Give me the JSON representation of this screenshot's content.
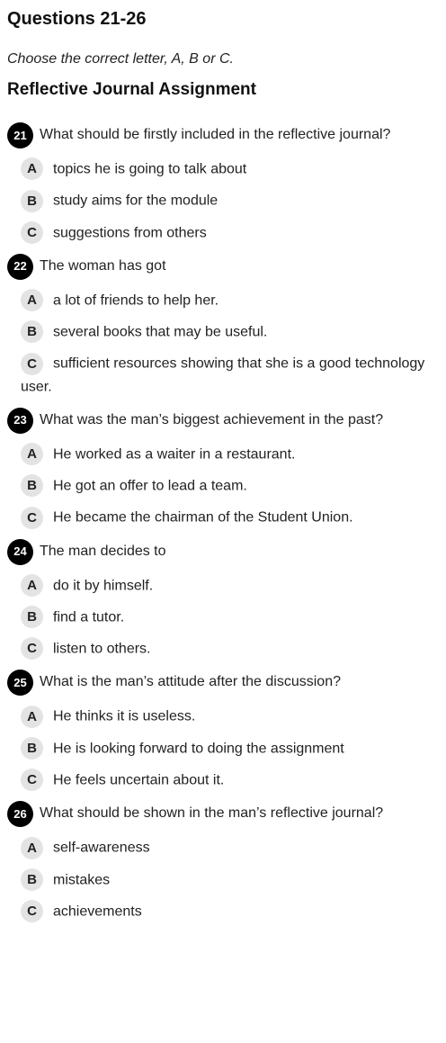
{
  "title": "Questions 21-26",
  "instruction": "Choose the correct letter, A, B or C.",
  "subtitle": "Reflective Journal Assignment",
  "questions": [
    {
      "number": "21",
      "text": "What should be firstly included in the reflective journal?",
      "options": [
        {
          "letter": "A",
          "text": "topics he is going to talk about"
        },
        {
          "letter": "B",
          "text": "study aims for the module"
        },
        {
          "letter": "C",
          "text": "suggestions from others"
        }
      ]
    },
    {
      "number": "22",
      "text": "The woman has got",
      "options": [
        {
          "letter": "A",
          "text": "a lot of friends to help her."
        },
        {
          "letter": "B",
          "text": "several books that may be useful."
        },
        {
          "letter": "C",
          "text": "sufficient resources showing that she is a good technology user."
        }
      ]
    },
    {
      "number": "23",
      "text": "What was the man’s biggest achievement in the past?",
      "options": [
        {
          "letter": "A",
          "text": "He worked as a waiter in a restaurant."
        },
        {
          "letter": "B",
          "text": "He got an offer to lead a team."
        },
        {
          "letter": "C",
          "text": "He became the chairman of the Student Union."
        }
      ]
    },
    {
      "number": "24",
      "text": "The man decides to",
      "options": [
        {
          "letter": "A",
          "text": "do it by himself."
        },
        {
          "letter": "B",
          "text": "find a tutor."
        },
        {
          "letter": "C",
          "text": "listen to others."
        }
      ]
    },
    {
      "number": "25",
      "text": "What is the man’s attitude after the discussion?",
      "options": [
        {
          "letter": "A",
          "text": "He thinks it is useless."
        },
        {
          "letter": "B",
          "text": "He is looking forward to doing the assignment"
        },
        {
          "letter": "C",
          "text": "He feels uncertain about it."
        }
      ]
    },
    {
      "number": "26",
      "text": "What should be shown in the man’s reflective journal?",
      "options": [
        {
          "letter": "A",
          "text": "self-awareness"
        },
        {
          "letter": "B",
          "text": "mistakes"
        },
        {
          "letter": "C",
          "text": "achievements"
        }
      ]
    }
  ]
}
